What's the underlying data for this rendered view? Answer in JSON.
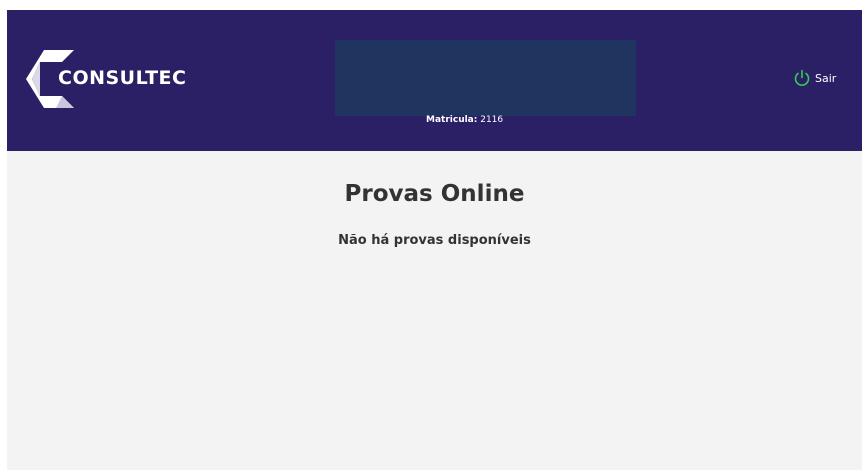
{
  "header": {
    "logo_text": "CONSULTEC",
    "matricula_label": "Matricula:",
    "matricula_value": "2116",
    "logout_label": "Sair"
  },
  "main": {
    "title": "Provas Online",
    "empty_message": "Não há provas disponíveis"
  },
  "icons": {
    "logo": "consultec-logo-icon",
    "logout": "power-icon"
  },
  "colors": {
    "header_bg": "#2b1f66",
    "user_box_bg": "#1f3560",
    "page_bg": "#f3f3f3",
    "logout_icon": "#33cc55"
  }
}
